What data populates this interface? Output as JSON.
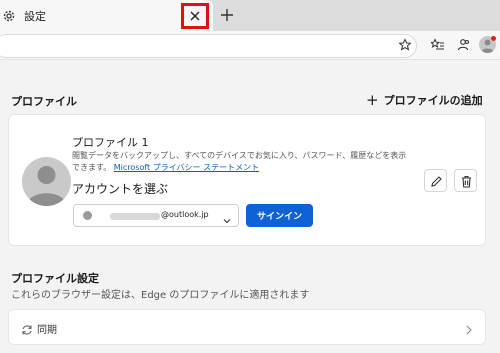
{
  "tab": {
    "title": "設定"
  },
  "profiles": {
    "section_title": "プロファイル",
    "add_profile_label": "プロファイルの追加",
    "profile_name": "プロファイル 1",
    "description": "閲覧データをバックアップし、すべてのデバイスでお気に入り、パスワード、履歴などを表示できます。",
    "privacy_link": "Microsoft プライバシー ステートメント",
    "choose_account_label": "アカウントを選ぶ",
    "account_email": "@outlook.jp",
    "signin_label": "サインイン"
  },
  "profile_settings": {
    "title": "プロファイル設定",
    "description": "これらのブラウザー設定は、Edge のプロファイルに適用されます",
    "sync_label": "同期"
  },
  "colors": {
    "accent": "#0f62d6",
    "highlight_border": "#e01010"
  }
}
